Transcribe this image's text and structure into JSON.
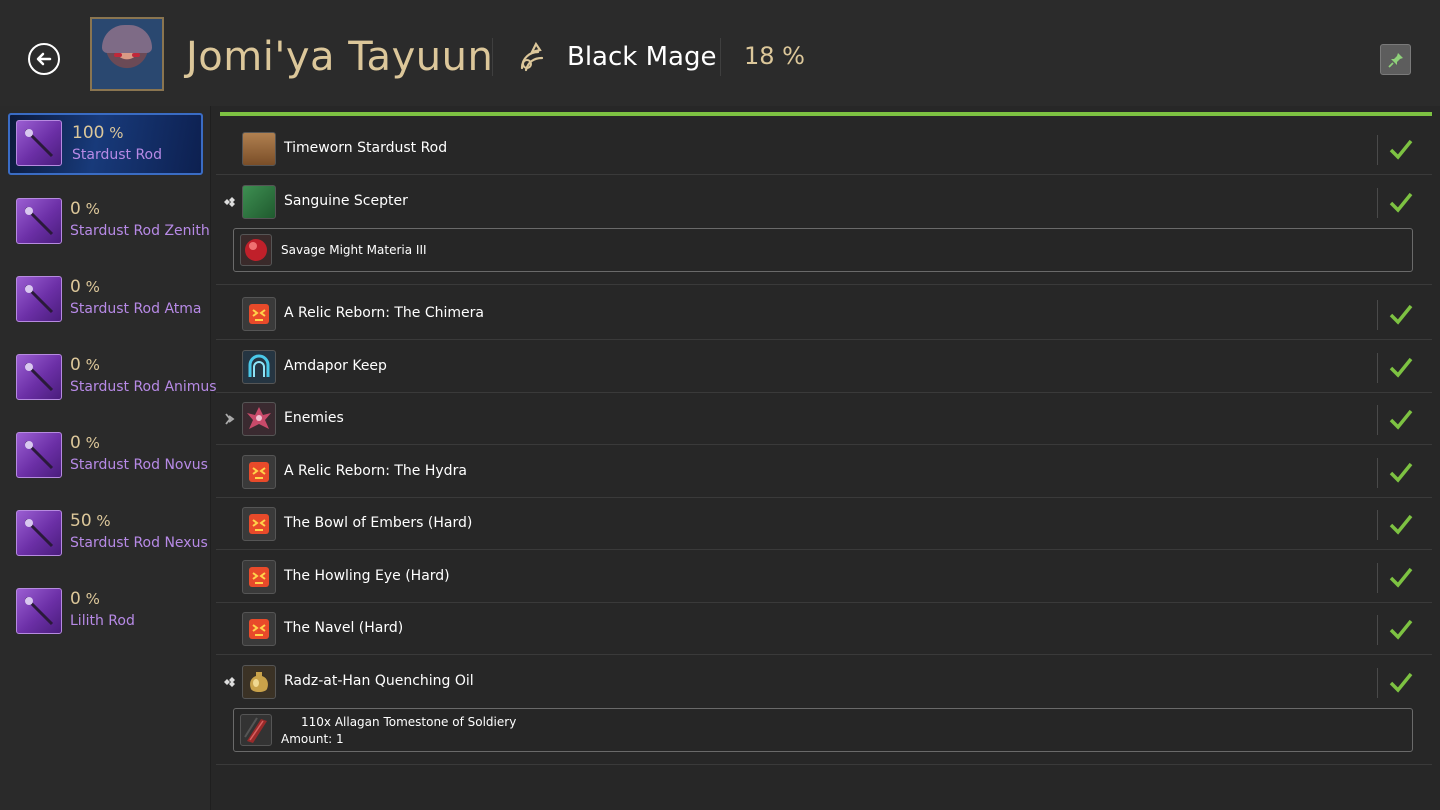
{
  "header": {
    "character_name": "Jomi'ya Tayuun",
    "job_name": "Black Mage",
    "job_progress": "18 %",
    "job_icon": "black-mage-icon",
    "back_icon": "back-arrow-icon",
    "pin_icon": "pin-icon"
  },
  "sidebar": {
    "items": [
      {
        "percent": "100",
        "percent_unit": "%",
        "label": "Stardust Rod",
        "active": true
      },
      {
        "percent": "0",
        "percent_unit": "%",
        "label": "Stardust Rod Zenith",
        "active": false
      },
      {
        "percent": "0",
        "percent_unit": "%",
        "label": "Stardust Rod Atma",
        "active": false
      },
      {
        "percent": "0",
        "percent_unit": "%",
        "label": "Stardust Rod Animus",
        "active": false
      },
      {
        "percent": "0",
        "percent_unit": "%",
        "label": "Stardust Rod Novus",
        "active": false
      },
      {
        "percent": "50",
        "percent_unit": "%",
        "label": "Stardust Rod Nexus",
        "active": false
      },
      {
        "percent": "0",
        "percent_unit": "%",
        "label": "Lilith Rod",
        "active": false
      }
    ]
  },
  "main": {
    "progress_fraction": 1.0,
    "colors": {
      "accent_green": "#7dc242",
      "gold": "#dcc79a",
      "purple": "#b78ae6"
    },
    "rows": [
      {
        "label": "Timeworn Stardust Rod",
        "icon": "chest-icon",
        "done": true
      },
      {
        "label": "Sanguine Scepter",
        "icon": "scepter-icon",
        "done": true,
        "expandable": true,
        "sub": {
          "label": "Savage Might Materia III",
          "icon": "materia-icon"
        }
      },
      {
        "label": "A Relic Reborn: The Chimera",
        "icon": "trial-icon",
        "done": true
      },
      {
        "label": "Amdapor Keep",
        "icon": "dungeon-icon",
        "done": true
      },
      {
        "label": "Enemies",
        "icon": "enemy-icon",
        "done": true,
        "expandable": true
      },
      {
        "label": "A Relic Reborn: The Hydra",
        "icon": "trial-icon",
        "done": true
      },
      {
        "label": "The Bowl of Embers (Hard)",
        "icon": "trial-icon",
        "done": true
      },
      {
        "label": "The Howling Eye (Hard)",
        "icon": "trial-icon",
        "done": true
      },
      {
        "label": "The Navel (Hard)",
        "icon": "trial-icon",
        "done": true
      },
      {
        "label": "Radz-at-Han Quenching Oil",
        "icon": "oil-icon",
        "done": true,
        "expandable": true,
        "sub": {
          "label": "110x Allagan Tomestone of Soldiery",
          "amount": "Amount: 1",
          "icon": "tomestone-icon"
        }
      }
    ]
  }
}
